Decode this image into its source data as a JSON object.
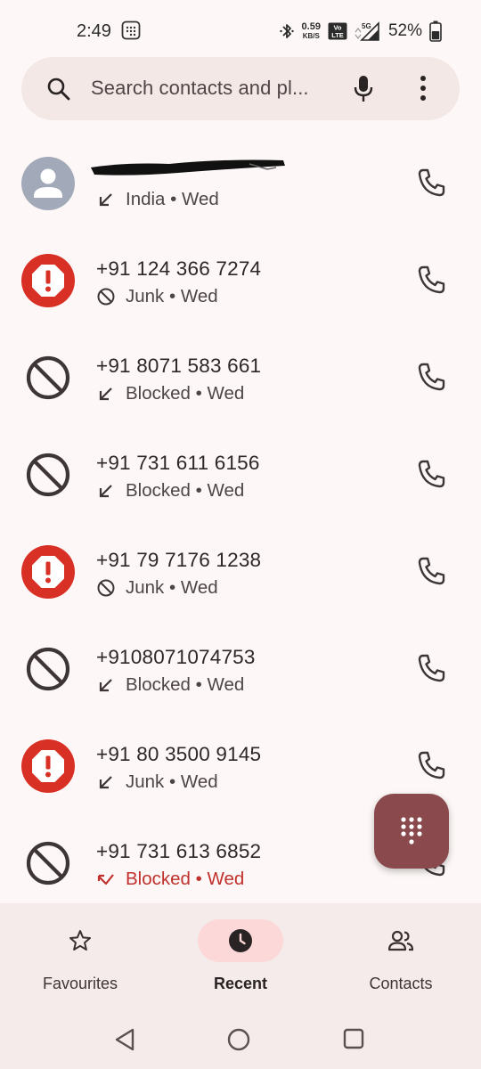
{
  "status_bar": {
    "time": "2:49",
    "net_speed_value": "0.59",
    "net_speed_unit": "KB/S",
    "volte": "Vo LTE",
    "network": "5G",
    "battery": "52%"
  },
  "search": {
    "placeholder": "Search contacts and pl..."
  },
  "calls": [
    {
      "name": "",
      "redacted": true,
      "avatar": "person-avatar",
      "direction": "incoming-arrow",
      "status": "India • Wed",
      "missed": false
    },
    {
      "name": "+91 124 366 7274",
      "avatar": "spam-warning-icon",
      "direction": "blocked-small-icon",
      "status": "Junk • Wed",
      "missed": false
    },
    {
      "name": "+91 8071 583 661",
      "avatar": "blocked-icon",
      "direction": "incoming-arrow",
      "status": "Blocked • Wed",
      "missed": false
    },
    {
      "name": "+91 731 611 6156",
      "avatar": "blocked-icon",
      "direction": "incoming-arrow",
      "status": "Blocked • Wed",
      "missed": false
    },
    {
      "name": "+91 79 7176 1238",
      "avatar": "spam-warning-icon",
      "direction": "blocked-small-icon",
      "status": "Junk • Wed",
      "missed": false
    },
    {
      "name": "+9108071074753",
      "avatar": "blocked-icon",
      "direction": "incoming-arrow",
      "status": "Blocked • Wed",
      "missed": false
    },
    {
      "name": "+91 80 3500 9145",
      "avatar": "spam-warning-icon",
      "direction": "incoming-arrow",
      "status": "Junk • Wed",
      "missed": false
    },
    {
      "name": "+91 731 613 6852",
      "avatar": "blocked-icon",
      "direction": "missed-call-arrow",
      "status": "Blocked • Wed",
      "missed": true
    }
  ],
  "bottom_nav": {
    "favourites": "Favourites",
    "recent": "Recent",
    "contacts": "Contacts",
    "active": "recent"
  },
  "colors": {
    "background": "#fdf8f7",
    "search_bg": "#f3e8e6",
    "spam_red": "#d93025",
    "missed_red": "#c0302c",
    "fab": "#8a4a4d",
    "nav_active_pill": "#fcd9d8",
    "avatar_grey": "#a2aab9"
  }
}
